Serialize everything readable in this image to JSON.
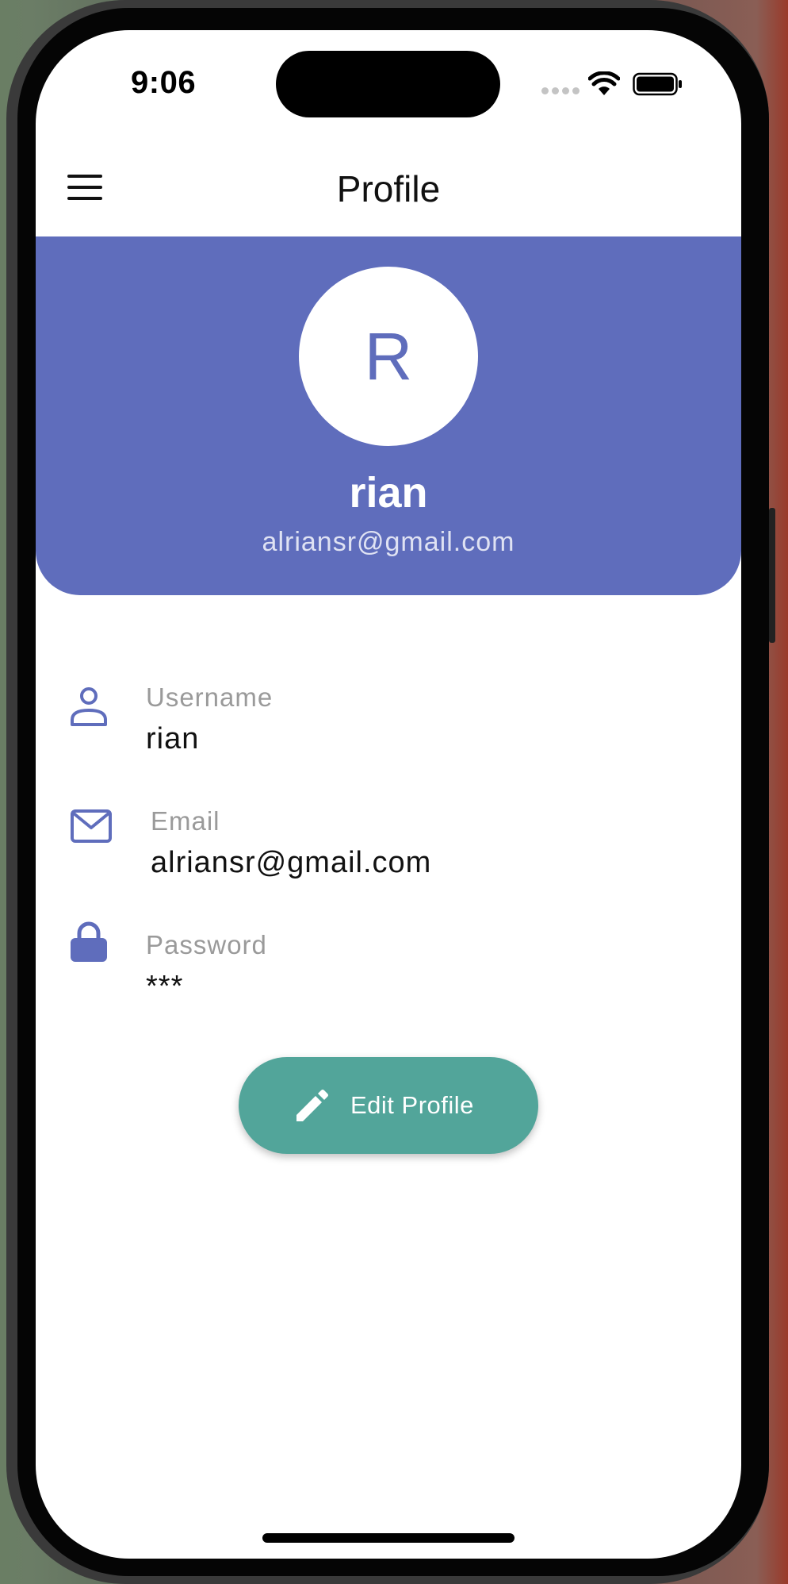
{
  "status_bar": {
    "time": "9:06"
  },
  "app_bar": {
    "title": "Profile",
    "menu_icon": "hamburger-menu-icon"
  },
  "header": {
    "avatar_initial": "R",
    "name": "rian",
    "email": "alriansr@gmail.com"
  },
  "fields": [
    {
      "icon": "person-icon",
      "label": "Username",
      "value": "rian"
    },
    {
      "icon": "mail-icon",
      "label": "Email",
      "value": "alriansr@gmail.com"
    },
    {
      "icon": "lock-icon",
      "label": "Password",
      "value": "***"
    }
  ],
  "actions": {
    "edit_label": "Edit Profile",
    "edit_icon": "pencil-icon"
  },
  "colors": {
    "primary": "#5f6dbc",
    "accent": "#52a59a"
  }
}
